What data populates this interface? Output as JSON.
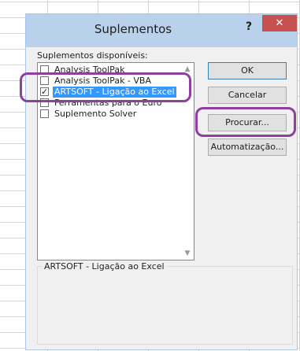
{
  "dialog": {
    "title": "Suplementos",
    "help_label": "?",
    "close_label": "✕"
  },
  "addins": {
    "label": "Suplementos disponíveis:",
    "items": [
      {
        "label": "Analysis ToolPak",
        "checked": false,
        "selected": false
      },
      {
        "label": "Analysis ToolPak - VBA",
        "checked": false,
        "selected": false
      },
      {
        "label": "ARTSOFT - Ligação ao Excel",
        "checked": true,
        "selected": true
      },
      {
        "label": "Ferramentas para o Euro",
        "checked": false,
        "selected": false
      },
      {
        "label": "Suplemento Solver",
        "checked": false,
        "selected": false
      }
    ],
    "checkmark": "✓"
  },
  "buttons": {
    "ok": "OK",
    "cancel": "Cancelar",
    "browse": "Procurar...",
    "automation": "Automatização..."
  },
  "description": {
    "title": "ARTSOFT - Ligação ao Excel"
  },
  "scroll": {
    "up_glyph": "▲",
    "down_glyph": "▼"
  },
  "colors": {
    "highlight": "#8e3fa0",
    "selection": "#3399ff",
    "close_button": "#c75050"
  }
}
